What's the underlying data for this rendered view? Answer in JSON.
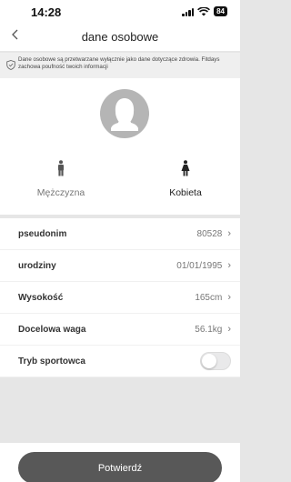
{
  "status_bar": {
    "time": "14:28",
    "battery": "84",
    "icons": [
      "signal-icon",
      "wifi-icon",
      "battery-icon"
    ]
  },
  "nav": {
    "title": "dane osobowe",
    "back_icon": "chevron-left-icon"
  },
  "notice": {
    "icon": "shield-check-icon",
    "text": "Dane osobowe są przetwarzane wyłącznie jako dane dotyczące zdrowia. Fitdays zachowa poufność twoich informacji"
  },
  "profile": {
    "avatar_icon": "person-silhouette-icon",
    "genders": [
      {
        "label": "Mężczyzna",
        "icon": "male-figure-icon",
        "selected": false
      },
      {
        "label": "Kobieta",
        "icon": "female-figure-icon",
        "selected": true
      }
    ]
  },
  "fields": [
    {
      "label": "pseudonim",
      "value": "80528"
    },
    {
      "label": "urodziny",
      "value": "01/01/1995"
    },
    {
      "label": "Wysokość",
      "value": "165cm"
    },
    {
      "label": "Docelowa waga",
      "value": "56.1kg"
    }
  ],
  "athlete_mode": {
    "label": "Tryb sportowca",
    "enabled": false
  },
  "confirm_button": {
    "label": "Potwierdź"
  },
  "colors": {
    "button": "#585858",
    "background": "#e6e6e6",
    "avatar": "#b5b5b5"
  }
}
